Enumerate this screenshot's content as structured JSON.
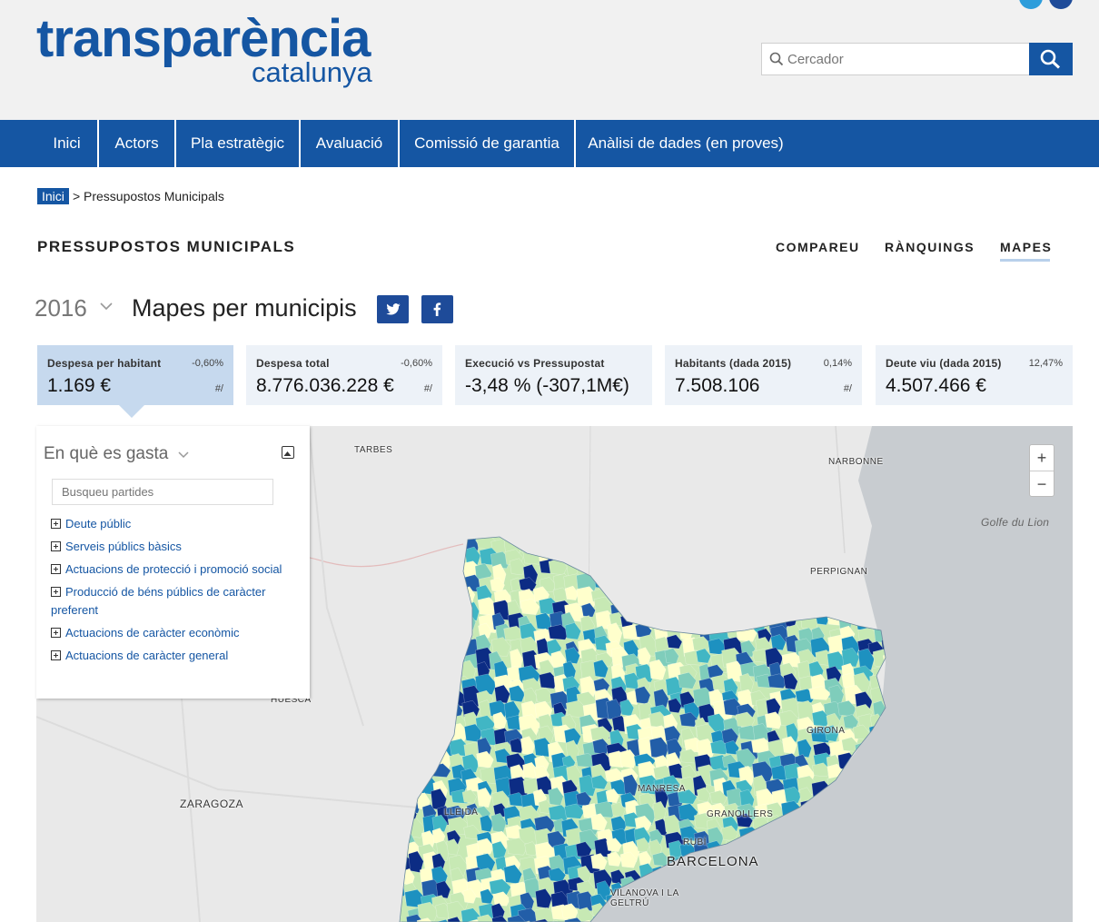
{
  "header": {
    "logo_main": "transparència",
    "logo_sub": "catalunya",
    "search_placeholder": "Cercador"
  },
  "nav": {
    "items": [
      "Inici",
      "Actors",
      "Pla estratègic",
      "Avaluació",
      "Comissió de garantia",
      "Anàlisi de dades (en proves)"
    ]
  },
  "breadcrumb": {
    "home": "Inici",
    "separator": ">",
    "current": "Pressupostos Municipals"
  },
  "section": {
    "title": "PRESSUPOSTOS MUNICIPALS",
    "tabs": [
      "COMPAREU",
      "RÀNQUINGS",
      "MAPES"
    ],
    "active_tab": "MAPES"
  },
  "view": {
    "year": "2016",
    "title": "Mapes per municipis"
  },
  "cards": [
    {
      "label": "Despesa per habitant",
      "change": "-0,60%",
      "value": "1.169 €",
      "hash": "#/",
      "active": true
    },
    {
      "label": "Despesa total",
      "change": "-0,60%",
      "value": "8.776.036.228 €",
      "hash": "#/",
      "active": false
    },
    {
      "label": "Execució vs Pressupostat",
      "change": "",
      "value": "-3,48 % (-307,1M€)",
      "hash": "",
      "active": false
    },
    {
      "label": "Habitants (dada 2015)",
      "change": "0,14%",
      "value": "7.508.106",
      "hash": "#/",
      "active": false
    },
    {
      "label": "Deute viu (dada 2015)",
      "change": "12,47%",
      "value": "4.507.466 €",
      "hash": "",
      "active": false
    }
  ],
  "panel": {
    "title": "En què es gasta",
    "search_placeholder": "Busqueu partides",
    "categories": [
      "Deute públic",
      "Serveis públics bàsics",
      "Actuacions de protecció i promoció social",
      "Producció de béns públics de caràcter preferent",
      "Actuacions de caràcter econòmic",
      "Actuacions de caràcter general"
    ]
  },
  "map": {
    "labels": {
      "tarbes": "TARBES",
      "narbonne": "NARBONNE",
      "golfe": "Golfe du Lion",
      "perpignan": "PERPIGNAN",
      "girona": "GIRONA",
      "zaragoza": "ZARAGOZA",
      "lleida": "LLEIDA",
      "manresa": "MANRESA",
      "granollers": "GRANOLLERS",
      "rubi": "RUBÍ",
      "barcelona": "BARCELONA",
      "vilanova": "VILANOVA I LA GELTRÚ",
      "huesca": "HUESCA"
    },
    "zoom_in": "+",
    "zoom_out": "−",
    "colors": {
      "sea": "#c8ccd0",
      "land": "#e9e9e9",
      "c1": "#ffffcc",
      "c2": "#c7e9b4",
      "c3": "#7fcdbb",
      "c4": "#41b6c4",
      "c5": "#1d91c0",
      "c6": "#225ea8",
      "c7": "#0c2c84"
    }
  }
}
